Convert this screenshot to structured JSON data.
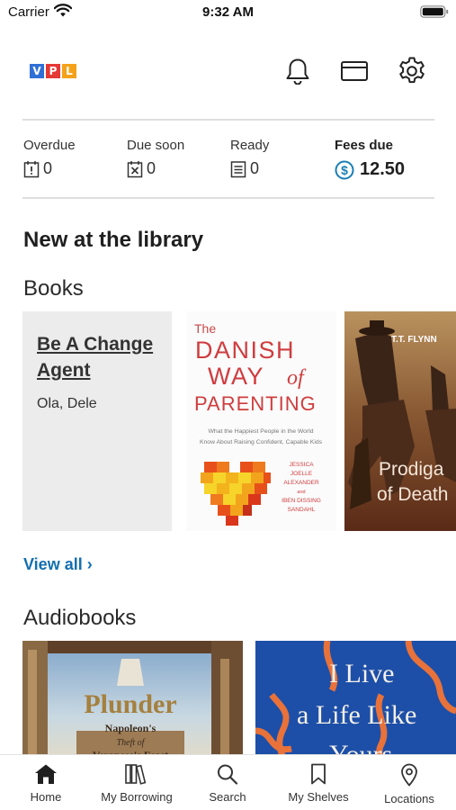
{
  "status_bar": {
    "carrier": "Carrier",
    "time": "9:32 AM"
  },
  "header": {
    "logo_letters": [
      "V",
      "P",
      "L"
    ],
    "logo_colors": [
      "#2f6fd6",
      "#e53935",
      "#f3a21a"
    ],
    "icons": [
      "bell-icon",
      "card-icon",
      "gear-icon"
    ]
  },
  "stats": {
    "overdue": {
      "label": "Overdue",
      "value": "0"
    },
    "due_soon": {
      "label": "Due soon",
      "value": "0"
    },
    "ready": {
      "label": "Ready",
      "value": "0"
    },
    "fees_due": {
      "label": "Fees due",
      "value": "12.50"
    }
  },
  "sections": {
    "new_at_library": "New at the library",
    "books": "Books",
    "view_all": "View all ›",
    "audiobooks": "Audiobooks"
  },
  "books": [
    {
      "title": "Be A Change Agent",
      "author": "Ola, Dele"
    },
    {
      "cover_the": "The",
      "cover_line1": "DANISH",
      "cover_line2": "WAY",
      "cover_of": "of",
      "cover_line3": "PARENTING",
      "cover_sub1": "What the Happiest People in the World",
      "cover_sub2": "Know About Raising Confident, Capable Kids",
      "cover_authors": [
        "JESSICA",
        "JOELLE",
        "ALEXANDER",
        "and",
        "IBEN DISSING",
        "SANDAHL"
      ]
    },
    {
      "cover_author": "T.T. FLYNN",
      "cover_title1": "Prodiga",
      "cover_title2": "of Death"
    }
  ],
  "audiobooks": [
    {
      "cover_title": "Plunder",
      "cover_sub1": "Napoleon's",
      "cover_sub2": "Theft of",
      "cover_sub3": "Veronese's Feast"
    },
    {
      "cover_line1": "I Live",
      "cover_line2": "a Life Like",
      "cover_line3": "Yours"
    }
  ],
  "tabs": [
    {
      "label": "Home",
      "icon": "home-icon"
    },
    {
      "label": "My Borrowing",
      "icon": "books-icon"
    },
    {
      "label": "Search",
      "icon": "search-icon"
    },
    {
      "label": "My Shelves",
      "icon": "bookmark-icon"
    },
    {
      "label": "Locations",
      "icon": "location-pin-icon"
    }
  ],
  "colors": {
    "accent": "#136fb0",
    "fees_icon": "#1a7fb5"
  }
}
